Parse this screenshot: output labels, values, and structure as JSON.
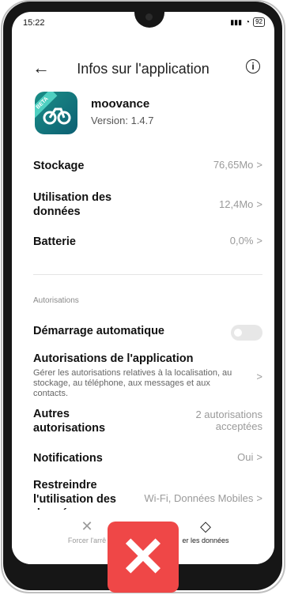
{
  "status": {
    "time": "15:22",
    "battery": "92"
  },
  "header": {
    "title": "Infos sur l'application"
  },
  "app": {
    "name": "moovance",
    "version": "Version: 1.4.7",
    "badge": "BETA"
  },
  "rows": {
    "storage": {
      "label": "Stockage",
      "value": "76,65Mo"
    },
    "data": {
      "label1": "Utilisation des",
      "label2": "données",
      "value": "12,4Mo"
    },
    "battery": {
      "label": "Batterie",
      "value": "0,0%"
    }
  },
  "permissions": {
    "section": "Autorisations",
    "autostart": "Démarrage automatique",
    "app_perms": {
      "label": "Autorisations de l'application",
      "desc": "Gérer les autorisations relatives à la localisation, au stockage, au téléphone, aux messages et aux contacts."
    },
    "other": {
      "label1": "Autres",
      "label2": "autorisations",
      "value1": "2 autorisations",
      "value2": "acceptées"
    },
    "notifications": {
      "label": "Notifications",
      "value": "Oui"
    },
    "restrict": {
      "label1": "Restreindre",
      "label2": "l'utilisation des",
      "label3": "données",
      "value": "Wi-Fi, Données Mobiles"
    }
  },
  "bottom": {
    "force_stop": "Forcer l'arrê",
    "clear_data": "er les données"
  }
}
